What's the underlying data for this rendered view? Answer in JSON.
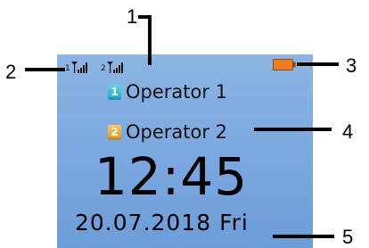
{
  "callouts": {
    "one": "1",
    "two": "2",
    "three": "3",
    "four": "4",
    "five": "5"
  },
  "status_bar": {
    "sim1_signal_label": "1",
    "sim2_signal_label": "2",
    "battery_color": "#ee7c22"
  },
  "operators": [
    {
      "badge": "1",
      "name": "Operator 1",
      "badge_color": "#22a8c8"
    },
    {
      "badge": "2",
      "name": "Operator 2",
      "badge_color": "#e09a21"
    }
  ],
  "clock": {
    "time": "12:45",
    "date": "20.07.2018 Fri"
  },
  "screen": {
    "background_color": "#7aa7df"
  }
}
